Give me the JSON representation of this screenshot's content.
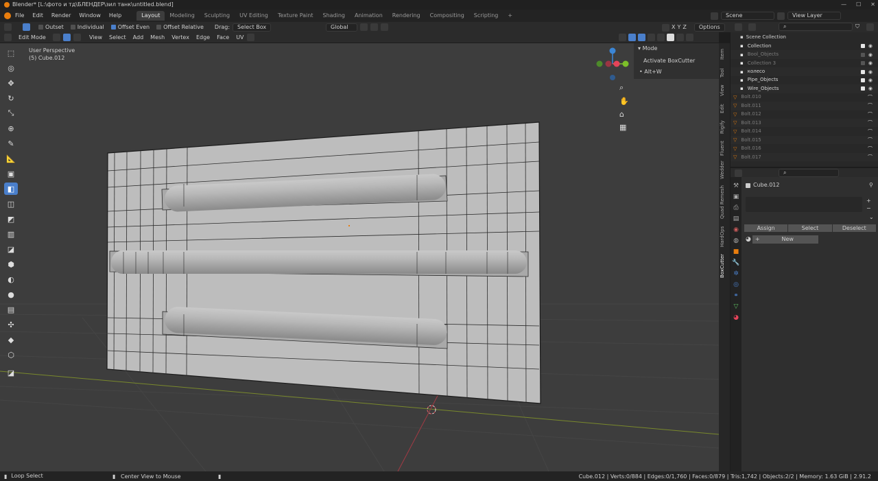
{
  "title": "Blender* [L:\\фото и тд\\БЛЕНДЕР\\зил танк\\untitled.blend]",
  "menu": [
    "File",
    "Edit",
    "Render",
    "Window",
    "Help"
  ],
  "workspaces": [
    "Layout",
    "Modeling",
    "Sculpting",
    "UV Editing",
    "Texture Paint",
    "Shading",
    "Animation",
    "Rendering",
    "Compositing",
    "Scripting"
  ],
  "scene": "Scene",
  "view_layer": "View Layer",
  "tool_header": {
    "outset": "Outset",
    "individual": "Individual",
    "offset_even": "Offset Even",
    "offset_relative": "Offset Relative",
    "drag_label": "Drag:",
    "drag_value": "Select Box",
    "orientation": "Global",
    "options": "Options",
    "axes": [
      "X",
      "Y",
      "Z"
    ]
  },
  "view_header": {
    "mode": "Edit Mode",
    "items": [
      "View",
      "Select",
      "Add",
      "Mesh",
      "Vertex",
      "Edge",
      "Face",
      "UV"
    ]
  },
  "viewport": {
    "perspective": "User Perspective",
    "object": "(5) Cube.012"
  },
  "npanel": {
    "header": "Mode",
    "action": "Activate BoxCutter",
    "shortcut": "• Alt+W"
  },
  "ntabs": [
    "Item",
    "Tool",
    "View",
    "Edit",
    "Rigify",
    "Fluent",
    "Wedder",
    "Quad Remesh",
    "HardOps",
    "BoxCutter"
  ],
  "outliner": {
    "root": "Scene Collection",
    "rows": [
      {
        "label": "Collection",
        "dim": false
      },
      {
        "label": "Bool_Objects",
        "dim": true
      },
      {
        "label": "Collection 3",
        "dim": true
      },
      {
        "label": "колесо",
        "dim": false
      },
      {
        "label": "Pipe_Objects",
        "dim": false
      },
      {
        "label": "Wire_Objects",
        "dim": false
      },
      {
        "label": "Bolt.010",
        "dim": true
      },
      {
        "label": "Bolt.011",
        "dim": true
      },
      {
        "label": "Bolt.012",
        "dim": true
      },
      {
        "label": "Bolt.013",
        "dim": true
      },
      {
        "label": "Bolt.014",
        "dim": true
      },
      {
        "label": "Bolt.015",
        "dim": true
      },
      {
        "label": "Bolt.016",
        "dim": true
      },
      {
        "label": "Bolt.017",
        "dim": true
      }
    ]
  },
  "props": {
    "object": "Cube.012",
    "assign": "Assign",
    "select": "Select",
    "deselect": "Deselect",
    "new": "New"
  },
  "status": {
    "left": "Loop Select",
    "middle": "Center View to Mouse",
    "right": "Cube.012 | Verts:0/884 | Edges:0/1,760 | Faces:0/879 | Tris:1,742 | Objects:2/2 | Memory: 1.63 GiB | 2.91.2"
  },
  "colors": {
    "accent": "#4a7fcb",
    "orange": "#e87d0d",
    "gizmo_x": "#e5435a",
    "gizmo_y": "#7cbf29",
    "gizmo_z": "#3b86d6"
  }
}
